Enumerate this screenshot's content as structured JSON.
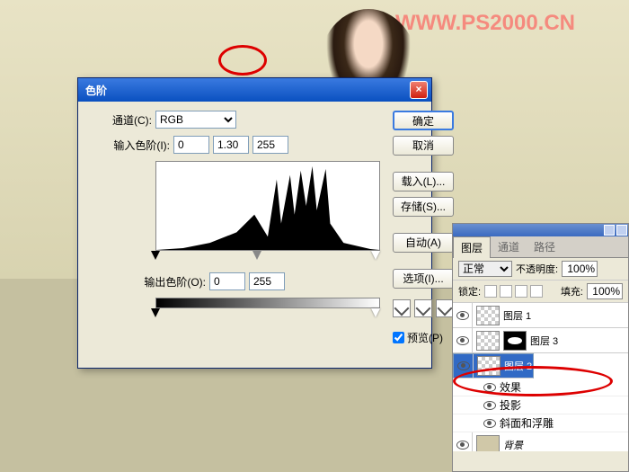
{
  "watermark": "WWW.PS2000.CN",
  "dialog": {
    "title": "色阶",
    "channel_label": "通道(C):",
    "channel_value": "RGB",
    "input_label": "输入色阶(I):",
    "input_black": "0",
    "input_gamma": "1.30",
    "input_white": "255",
    "output_label": "输出色阶(O):",
    "output_black": "0",
    "output_white": "255",
    "buttons": {
      "ok": "确定",
      "cancel": "取消",
      "load": "载入(L)...",
      "save": "存储(S)...",
      "auto": "自动(A)",
      "options": "选项(I)..."
    },
    "preview": "预览(P)"
  },
  "layers": {
    "tabs": [
      "图层",
      "通道",
      "路径"
    ],
    "blend_mode": "正常",
    "opacity_label": "不透明度:",
    "opacity": "100%",
    "lock_label": "锁定:",
    "fill_label": "填充:",
    "fill": "100%",
    "items": [
      {
        "name": "图层 1"
      },
      {
        "name": "图层 3"
      },
      {
        "name": "图层 2"
      },
      {
        "name": "背景"
      }
    ],
    "fx": {
      "effects": "效果",
      "drop_shadow": "投影",
      "bevel": "斜面和浮雕"
    }
  }
}
